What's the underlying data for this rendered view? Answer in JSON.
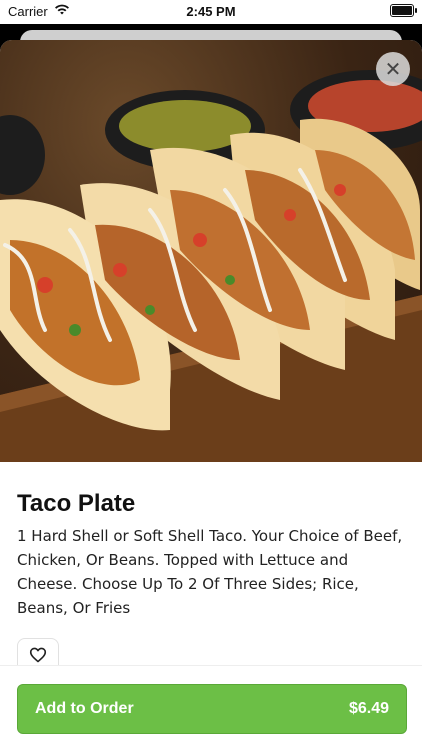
{
  "status_bar": {
    "carrier": "Carrier",
    "time": "2:45 PM"
  },
  "item": {
    "title": "Taco Plate",
    "description": "1 Hard Shell or Soft Shell Taco. Your Choice of Beef, Chicken, Or Beans. Topped with Lettuce and Cheese. Choose Up To 2 Of Three Sides; Rice, Beans, Or Fries"
  },
  "actions": {
    "add_to_order_label": "Add to Order",
    "price": "$6.49"
  },
  "colors": {
    "accent": "#6cbf46"
  },
  "icons": {
    "close": "close-icon",
    "favorite": "heart-icon",
    "wifi": "wifi-icon",
    "battery": "battery-icon"
  }
}
